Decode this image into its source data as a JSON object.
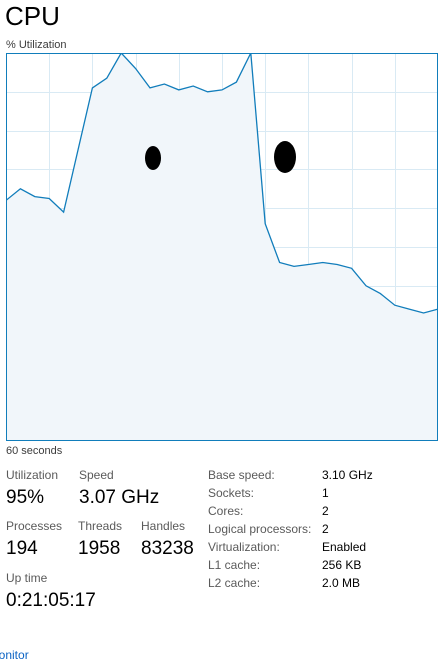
{
  "header": {
    "title": "CPU",
    "y_axis_label": "% Utilization",
    "x_axis_label": "60 seconds"
  },
  "chart_data": {
    "type": "area",
    "ylim": [
      0,
      100
    ],
    "grid": true,
    "x": [
      0,
      2,
      4,
      6,
      8,
      10,
      12,
      14,
      16,
      18,
      20,
      22,
      24,
      26,
      28,
      30,
      32,
      34,
      36,
      38,
      40,
      42,
      44,
      46,
      48,
      50,
      52,
      54,
      56,
      58,
      60
    ],
    "values": [
      62,
      65,
      63,
      62.5,
      59,
      75,
      91,
      93.5,
      100,
      96,
      91,
      92,
      90.5,
      91.5,
      90,
      90.5,
      92.5,
      100,
      56,
      46,
      45,
      45.5,
      46,
      45.5,
      44.5,
      40,
      38,
      35,
      34,
      33,
      34
    ],
    "stroke_color": "#117dbb",
    "fill_color": "#f1f6fa",
    "grid_color": "#d9eaf4"
  },
  "stats": {
    "utilization": {
      "label": "Utilization",
      "value": "95%"
    },
    "speed": {
      "label": "Speed",
      "value": "3.07 GHz"
    },
    "processes": {
      "label": "Processes",
      "value": "194"
    },
    "threads": {
      "label": "Threads",
      "value": "1958"
    },
    "handles": {
      "label": "Handles",
      "value": "83238"
    },
    "uptime": {
      "label": "Up time",
      "value": "0:21:05:17"
    }
  },
  "specs": [
    {
      "key": "Base speed:",
      "value": "3.10 GHz"
    },
    {
      "key": "Sockets:",
      "value": "1"
    },
    {
      "key": "Cores:",
      "value": "2"
    },
    {
      "key": "Logical processors:",
      "value": "2"
    },
    {
      "key": "Virtualization:",
      "value": "Enabled"
    },
    {
      "key": "L1 cache:",
      "value": "256 KB"
    },
    {
      "key": "L2 cache:",
      "value": "2.0 MB"
    }
  ],
  "footer": {
    "monitor_link": "lonitor"
  }
}
